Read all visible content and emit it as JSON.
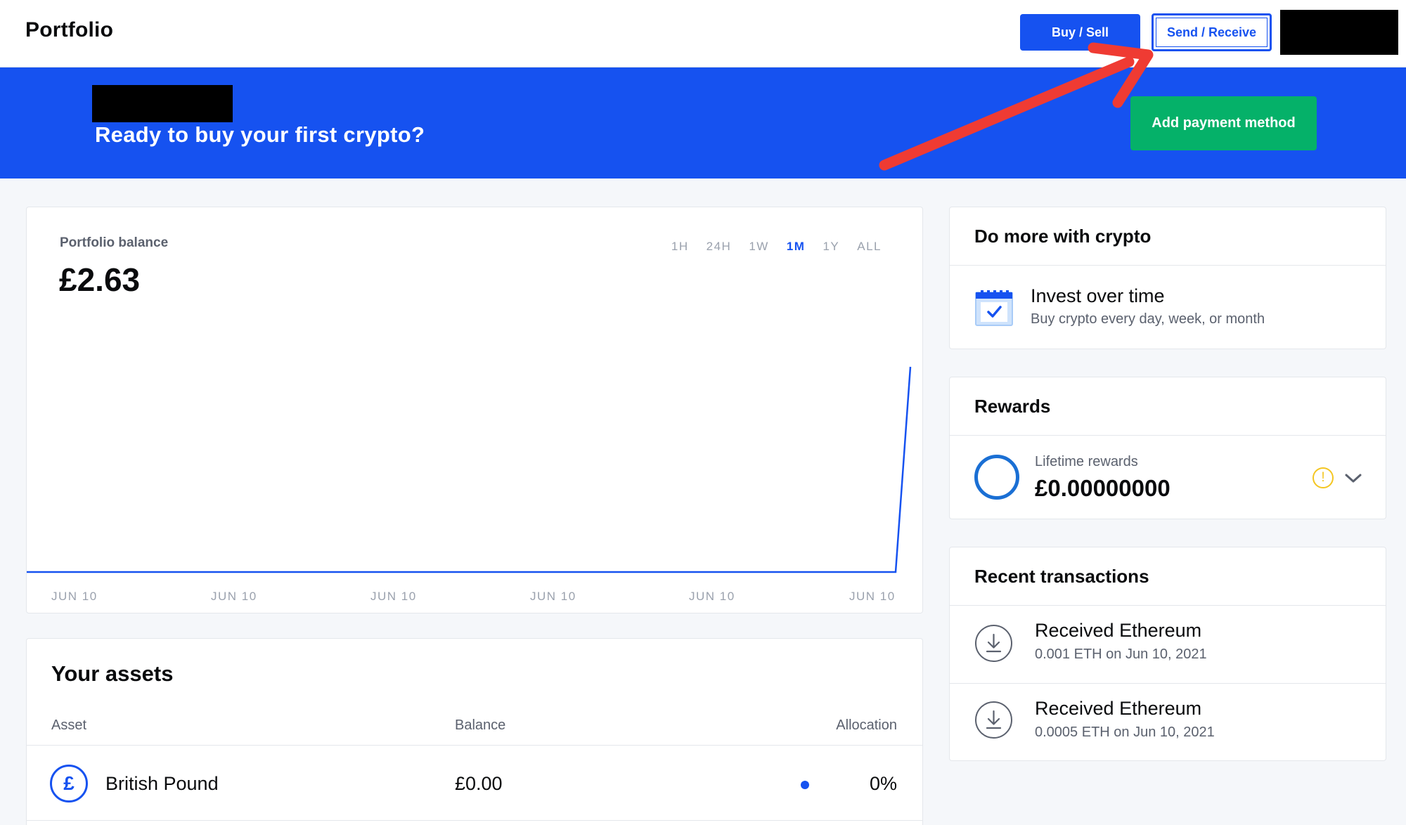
{
  "header": {
    "title": "Portfolio",
    "buy_sell_label": "Buy / Sell",
    "send_receive_label": "Send / Receive"
  },
  "banner": {
    "text": "Ready to buy your first crypto?",
    "cta_label": "Add payment method"
  },
  "portfolio": {
    "label": "Portfolio balance",
    "value": "£2.63",
    "ranges": [
      "1H",
      "24H",
      "1W",
      "1M",
      "1Y",
      "ALL"
    ],
    "active_range": "1M"
  },
  "chart_data": {
    "type": "line",
    "x": [
      "JUN 10",
      "JUN 10",
      "JUN 10",
      "JUN 10",
      "JUN 10",
      "JUN 10"
    ],
    "series": [
      {
        "values": [
          0,
          0,
          0,
          0,
          0,
          0,
          0,
          0,
          0,
          0,
          0,
          0,
          0,
          0,
          0,
          0,
          0,
          0,
          0,
          0,
          0,
          0,
          0,
          0,
          0,
          0,
          0,
          0,
          0,
          2.63
        ]
      }
    ],
    "color": "#1652f0",
    "grid": false
  },
  "assets": {
    "title": "Your assets",
    "columns": [
      "Asset",
      "Balance",
      "Allocation"
    ],
    "rows": [
      {
        "symbol": "£",
        "name": "British Pound",
        "balance": "£0.00",
        "allocation": "0%"
      }
    ]
  },
  "do_more": {
    "title": "Do more with crypto",
    "item_title": "Invest over time",
    "item_sub": "Buy crypto every day, week, or month",
    "icon": "calendar-check-icon"
  },
  "rewards": {
    "title": "Rewards",
    "label": "Lifetime rewards",
    "value": "£0.00000000",
    "warn_glyph": "!"
  },
  "transactions": {
    "title": "Recent transactions",
    "items": [
      {
        "title": "Received Ethereum",
        "sub": "0.001 ETH on Jun 10, 2021"
      },
      {
        "title": "Received Ethereum",
        "sub": "0.0005 ETH on Jun 10, 2021"
      }
    ]
  },
  "colors": {
    "brand_blue": "#1652f0",
    "green": "#05b169",
    "annotation_red": "#ef3b33"
  }
}
